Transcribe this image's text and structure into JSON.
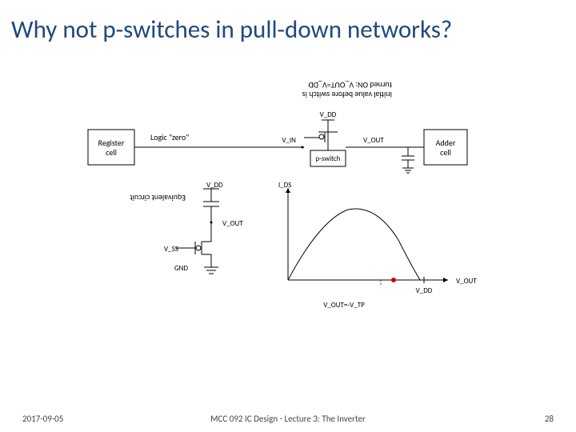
{
  "title": "Why not p-switches in pull-down networks?",
  "diagram": {
    "upside_line1": "Initial value before switch is",
    "upside_line2": "turned ON: V_OUT=V_DD",
    "register": "Register",
    "cell": "cell",
    "logic_zero": "Logic \"zero\"",
    "vdd": "V_DD",
    "vin": "V_IN",
    "vout": "V_OUT",
    "pswitch": "p-switch",
    "adder": "Adder",
    "equiv": "Equivalent circuit",
    "ids": "I_DS",
    "vss": "V_SS",
    "gnd": "GND",
    "axis_x": "V_DD",
    "axis_y": "V_OUT",
    "curve_label": "V_OUT=-V_TP"
  },
  "footer": {
    "date": "2017-09-05",
    "center": "MCC 092 IC Design - Lecture 3: The Inverter",
    "page": "28"
  }
}
